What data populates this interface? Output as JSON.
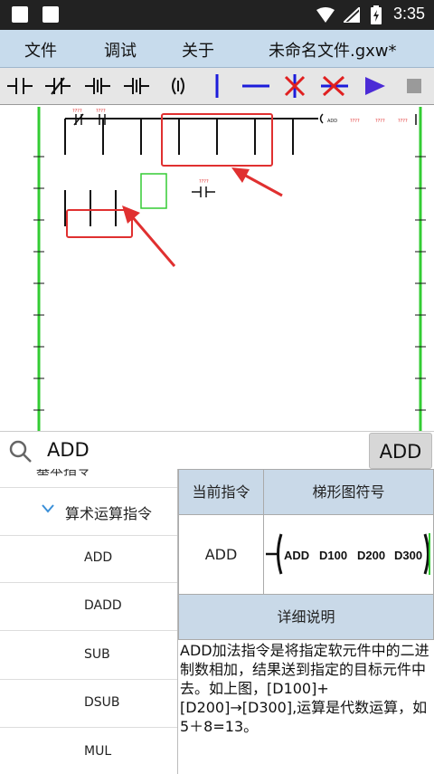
{
  "status_bar": {
    "time": "3:35"
  },
  "menu": {
    "file": "文件",
    "debug": "调试",
    "about": "关于",
    "filename": "未命名文件.gxw*"
  },
  "toolbar": {
    "icons": [
      "contact-no-icon",
      "contact-nc-icon",
      "contact-rising-icon",
      "contact-falling-icon",
      "coil-icon",
      "vertical-line-icon",
      "horizontal-line-icon",
      "delete-vertical-icon",
      "delete-horizontal-icon",
      "run-icon",
      "stop-icon"
    ],
    "colors": {
      "blue": "#1c1cdb",
      "red": "#e02020",
      "purple": "#4b2bd6"
    }
  },
  "canvas": {
    "rail_color": "#33cc33",
    "highlight_color": "#e03030",
    "instr_labels": [
      "ADD",
      "????",
      "????",
      "????"
    ],
    "contact_labels": [
      "????",
      "????"
    ],
    "free_contact_label": "????"
  },
  "search": {
    "value": "ADD",
    "button": "ADD"
  },
  "sidebar": {
    "partial_label": "基本指令",
    "category": "算术运算指令",
    "items": [
      "ADD",
      "DADD",
      "SUB",
      "DSUB",
      "MUL"
    ]
  },
  "detail": {
    "col_current": "当前指令",
    "col_symbol": "梯形图符号",
    "current_value": "ADD",
    "symbol_parts": [
      "ADD",
      "D100",
      "D200",
      "D300"
    ],
    "section_title": "详细说明",
    "description": "ADD加法指令是将指定软元件中的二进制数相加，结果送到指定的目标元件中去。如上图，[D100]+[D200]→[D300],运算是代数运算，如 5＋8=13。"
  }
}
